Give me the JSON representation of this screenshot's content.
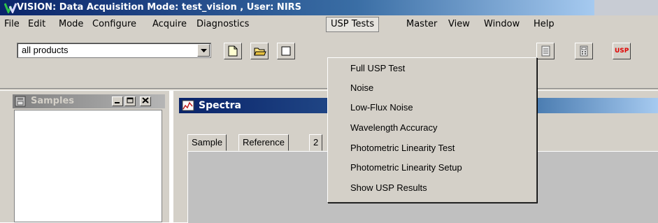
{
  "app": {
    "title": "VISION: Data Acquisition Mode: test_vision , User: NIRS"
  },
  "menubar": {
    "items": [
      "File",
      "Edit",
      "Mode",
      "Configure",
      "Acquire",
      "Diagnostics",
      "USP Tests",
      "Master",
      "View",
      "Window",
      "Help"
    ],
    "active": "USP Tests"
  },
  "toolbar": {
    "product_select": "all products",
    "usp_button_label": "USP"
  },
  "samples_window": {
    "title": "Samples"
  },
  "spectra_window": {
    "title": "Spectra",
    "tabs": [
      "Sample",
      "Reference",
      "2"
    ]
  },
  "usp_menu": {
    "items": [
      "Full USP Test",
      "Noise",
      "Low-Flux Noise",
      "Wavelength Accuracy",
      "Photometric Linearity Test",
      "Photometric Linearity Setup",
      "Show USP Results"
    ]
  },
  "colors": {
    "title_active": "#0a246a",
    "face": "#d4d0c8",
    "usp_red": "#e00000"
  }
}
